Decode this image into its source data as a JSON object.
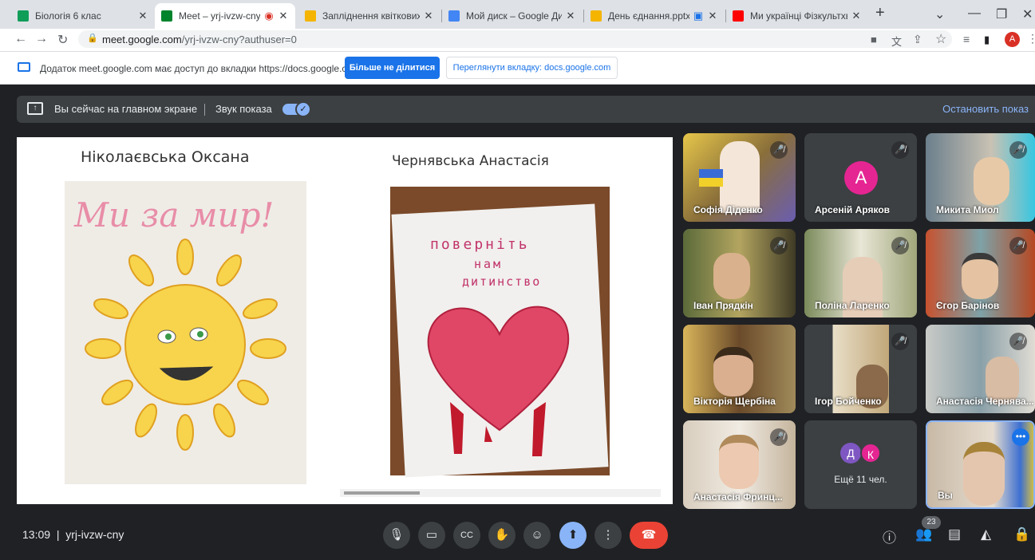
{
  "browser": {
    "tabs": [
      {
        "label": "Біологія 6 клас",
        "color": "#0f9d58"
      },
      {
        "label": "Meet – yrj-ivzw-cny",
        "color": "#00832d"
      },
      {
        "label": "Запліднення квіткових ро",
        "color": "#f4b400"
      },
      {
        "label": "Мой диск – Google Диск",
        "color": "#4285f4"
      },
      {
        "label": "День єднання.pptx - G",
        "color": "#f4b400"
      },
      {
        "label": "Ми українці Фізкультхвил",
        "color": "#ff0000"
      }
    ],
    "url_host": "meet.google.com",
    "url_path": "/yrj-ivzw-cny?authuser=0",
    "profile_letter": "A"
  },
  "infobar": {
    "message": "Додаток meet.google.com має доступ до вкладки https://docs.google.com",
    "stop_sharing": "Більше не ділитися",
    "view_tab": "Переглянути вкладку: docs.google.com"
  },
  "presenting": {
    "status": "Вы сейчас на главном экране",
    "audio": "Звук показа",
    "stop": "Остановить показ"
  },
  "slide": {
    "left_name": "Ніколаєвська Оксана",
    "right_name": "Чернявська Анастасія",
    "left_drawing_text": "Ми за мир!",
    "right_drawing_text_1": "поверніть",
    "right_drawing_text_2": "нам",
    "right_drawing_text_3": "дитинство"
  },
  "participants": [
    {
      "name": "Софія Діденко",
      "bg": "#b9a26a"
    },
    {
      "name": "Арсеній Аряков",
      "bg": "#3c4043",
      "letter": "A"
    },
    {
      "name": "Микита Миол",
      "bg": "#6b7f8c"
    },
    {
      "name": "Іван Прядкін",
      "bg": "#8d8757"
    },
    {
      "name": "Поліна Ларенко",
      "bg": "#b8b39a"
    },
    {
      "name": "Єгор Барінов",
      "bg": "#a35a3a"
    },
    {
      "name": "Вікторія Щербіна",
      "bg": "#7b5a3a"
    },
    {
      "name": "Ігор Бойченко",
      "bg": "#9b8a6a"
    },
    {
      "name": "Анастасія Чернява...",
      "bg": "#9da7a8"
    },
    {
      "name": "Анастасія Фринц...",
      "bg": "#d8cdbd"
    },
    {
      "name": "Ещё 11 чел.",
      "bg": "#3c4043"
    },
    {
      "name": "Вы",
      "bg": "#c8b9a6"
    }
  ],
  "more_avatars": [
    "Д",
    "К"
  ],
  "meeting": {
    "time": "13:09",
    "code": "yrj-ivzw-cny",
    "people_count": "23"
  }
}
